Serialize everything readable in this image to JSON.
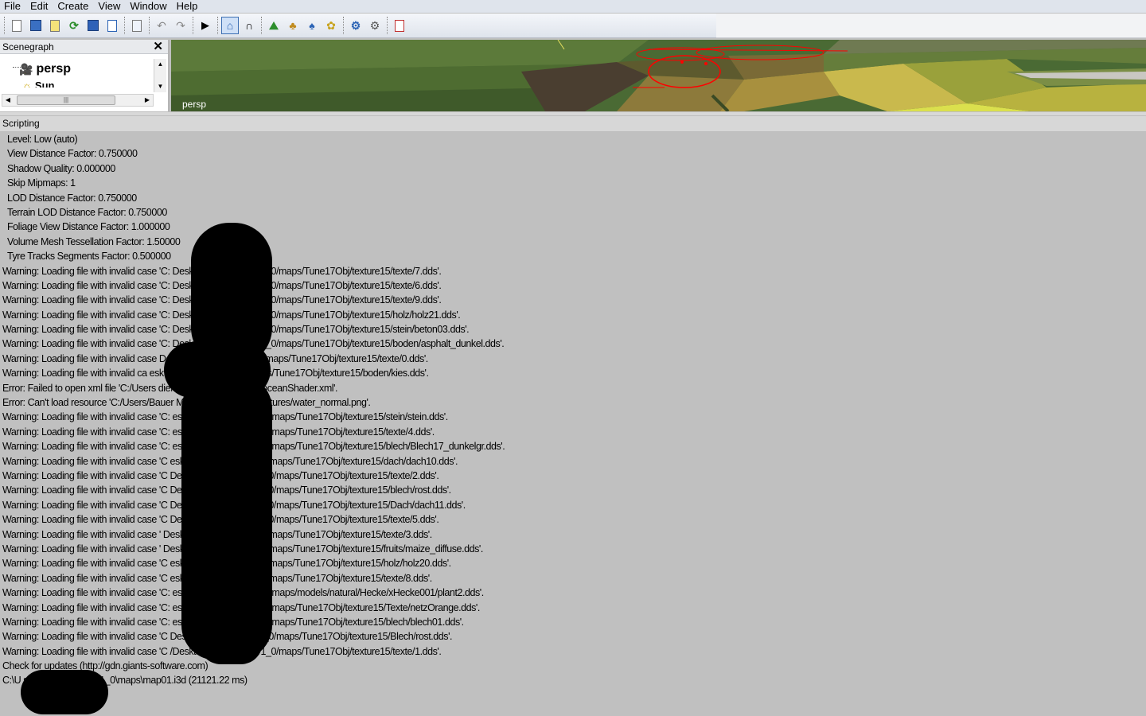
{
  "menu": [
    "File",
    "Edit",
    "Create",
    "View",
    "Window",
    "Help"
  ],
  "toolbar": {
    "icons": [
      "new-file-icon",
      "open-icon",
      "edit-icon",
      "refresh-icon",
      "save-icon",
      "export-icon",
      "help-icon",
      "undo-icon",
      "redo-icon",
      "play-icon",
      "home-icon",
      "magnet-icon",
      "terrain-icon",
      "foliage-icon",
      "paint-icon",
      "plant-icon",
      "settings-icon",
      "tools-icon",
      "exit-icon"
    ]
  },
  "scenegraph": {
    "title": "Scenegraph",
    "close": "✕",
    "items": [
      "persp",
      "Sun"
    ]
  },
  "viewport": {
    "label": "persp"
  },
  "scripting": {
    "title": "Scripting",
    "lines": [
      "Level: Low (auto)",
      "View Distance Factor: 0.750000",
      "Shadow Quality: 0.000000",
      "Skip Mipmaps: 1",
      "LOD Distance Factor: 0.750000",
      "Terrain LOD Distance Factor: 0.750000",
      "Foliage View Distance Factor: 1.000000",
      "Volume Mesh Tessellation Factor: 1.50000",
      "Tyre Tracks Segments Factor: 0.500000",
      "Warning: Loading file with invalid case 'C:                                    Desktop/Oltenheim_v1_0/maps/Tune17Obj/texture15/texte/7.dds'.",
      "Warning: Loading file with invalid case 'C:                                    Desktop/Oltenheim_v1_0/maps/Tune17Obj/texture15/texte/6.dds'.",
      "Warning: Loading file with invalid case 'C:                                    Desktop/Oltenheim_v1_0/maps/Tune17Obj/texture15/texte/9.dds'.",
      "Warning: Loading file with invalid case 'C:                                    Desktop/Oltenheim_v1_0/maps/Tune17Obj/texture15/holz/holz21.dds'.",
      "Warning: Loading file with invalid case 'C:                                    Desktop/Oltenheim_v1_0/maps/Tune17Obj/texture15/stein/beton03.dds'.",
      "Warning: Loading file with invalid case 'C:                                    Desktop/Oltenheim_v1_0/maps/Tune17Obj/texture15/boden/asphalt_dunkel.dds'.",
      "Warning: Loading file with invalid case                                      Desktop/Oltenheim_v1_0/maps/Tune17Obj/texture15/texte/0.dds'.",
      "Warning: Loading file with invalid ca                                        esktop/Oltenheim_v1_0/maps/Tune17Obj/texture15/boden/kies.dds'.",
      "Error: Failed to open xml file 'C:/Users                                     dieMap_v3_0_0/shaders/oceanShader.xml'.",
      "Error: Can't load resource 'C:/Users/Bauer                                   Map_v3_0_0/maps/textures/water_normal.png'.",
      "Warning: Loading file with invalid case 'C:                                   esktop/Oltenheim_v1_0/maps/Tune17Obj/texture15/stein/stein.dds'.",
      "Warning: Loading file with invalid case 'C:                                   esktop/Oltenheim_v1_0/maps/Tune17Obj/texture15/texte/4.dds'.",
      "Warning: Loading file with invalid case 'C:                                   esktop/Oltenheim_v1_0/maps/Tune17Obj/texture15/blech/Blech17_dunkelgr.dds'.",
      "Warning: Loading file with invalid case 'C                                    esktop/Oltenheim_v1_0/maps/Tune17Obj/texture15/dach/dach10.dds'.",
      "Warning: Loading file with invalid case 'C                                    Desktop/Oltenheim_v1_0/maps/Tune17Obj/texture15/texte/2.dds'.",
      "Warning: Loading file with invalid case 'C                                    Desktop/Oltenheim_v1_0/maps/Tune17Obj/texture15/blech/rost.dds'.",
      "Warning: Loading file with invalid case 'C                                    Desktop/Oltenheim_v1_0/maps/Tune17Obj/texture15/Dach/dach11.dds'.",
      "Warning: Loading file with invalid case 'C                                    Desktop/Oltenheim_v1_0/maps/Tune17Obj/texture15/texte/5.dds'.",
      "Warning: Loading file with invalid case '                                     Desktop/Oltenheim_v1_0/maps/Tune17Obj/texture15/texte/3.dds'.",
      "Warning: Loading file with invalid case '                                     Desktop/Oltenheim_v1_0/maps/Tune17Obj/texture15/fruits/maize_diffuse.dds'.",
      "Warning: Loading file with invalid case 'C                                    esktop/Oltenheim_v1_0/maps/Tune17Obj/texture15/holz/holz20.dds'.",
      "Warning: Loading file with invalid case 'C                                    esktop/Oltenheim_v1_0/maps/Tune17Obj/texture15/texte/8.dds'.",
      "Warning: Loading file with invalid case 'C:                                   esktop/Oltenheim_v1_0/maps/models/natural/Hecke/xHecke001/plant2.dds'.",
      "Warning: Loading file with invalid case 'C:                                   esktop/Oltenheim_v1_0/maps/Tune17Obj/texture15/Texte/netzOrange.dds'.",
      "Warning: Loading file with invalid case 'C:                                   esktop/Oltenheim_v1_0/maps/Tune17Obj/texture15/blech/blech01.dds'.",
      "Warning: Loading file with invalid case 'C                                    Desktop/Oltenheim_v1_0/maps/Tune17Obj/texture15/Blech/rost.dds'.",
      "Warning: Loading file with invalid case 'C                                    /Desktop/Oltenheim_v1_0/maps/Tune17Obj/texture15/texte/1.dds'.",
      "Check for updates (http://gdn.giants-software.com)",
      "C:\\U                       sktop\\Oltenheim_v1_0\\maps\\map01.i3d (21121.22 ms)"
    ]
  }
}
